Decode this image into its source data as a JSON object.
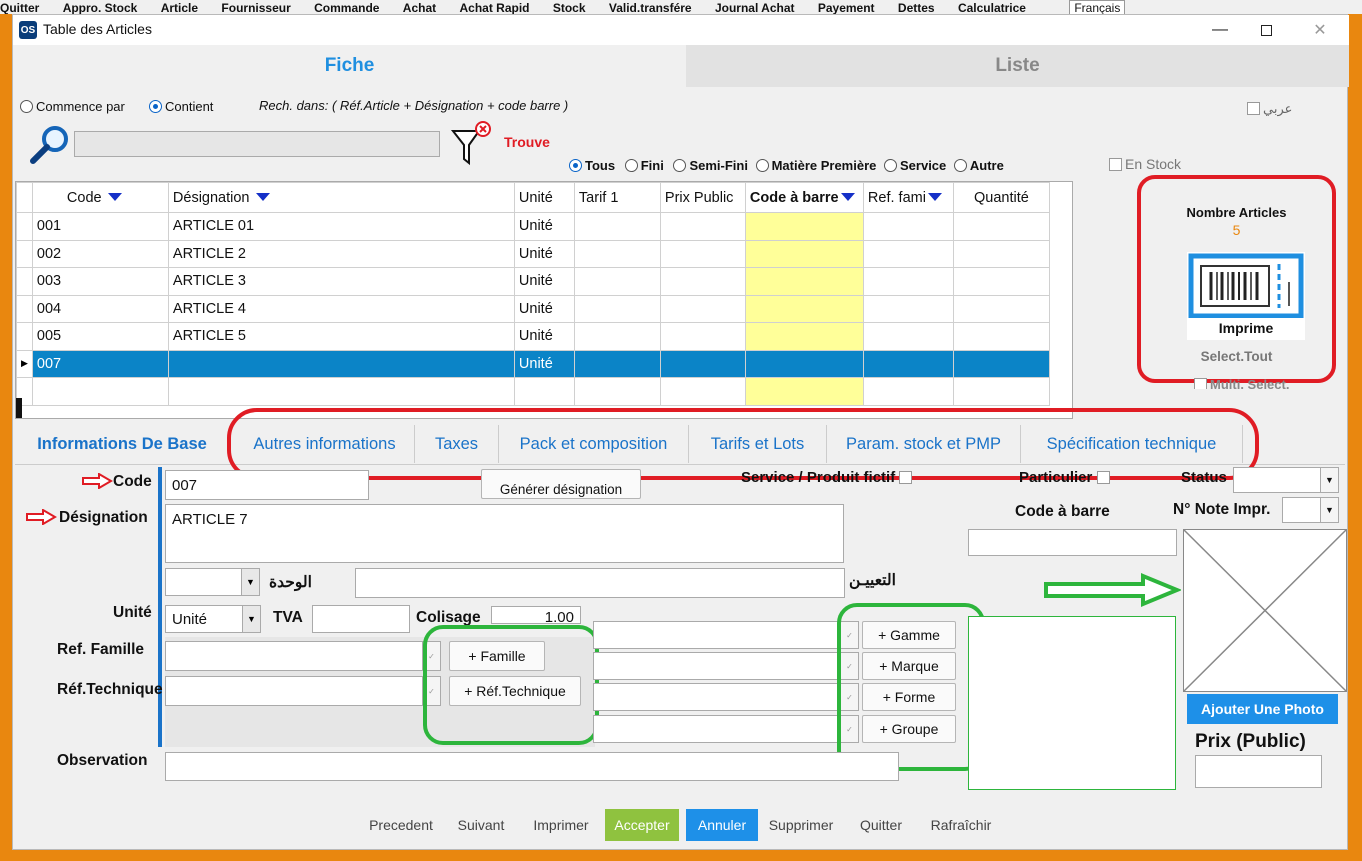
{
  "background_menubar": [
    "Quitter",
    "Appro. Stock",
    "Article",
    "Fournisseur",
    "Commande",
    "Achat",
    "Achat Rapid",
    "Stock",
    "Valid.transfére",
    "Journal Achat",
    "Payement",
    "Dettes",
    "Calculatrice",
    "Français"
  ],
  "window": {
    "logo": "OS",
    "title": "Table des Articles"
  },
  "top_tabs": {
    "fiche": "Fiche",
    "liste": "Liste"
  },
  "search": {
    "commence_par": "Commence par",
    "contient": "Contient",
    "rech_dans": "Rech. dans: ( Réf.Article + Désignation + code barre )",
    "arabic_check": "عربي",
    "value": "",
    "trouve": "Trouve",
    "filters": [
      "Tous",
      "Fini",
      "Semi-Fini",
      "Matière Première",
      "Service",
      "Autre"
    ],
    "selected_filter": "Tous",
    "en_stock": "En Stock"
  },
  "grid": {
    "columns": [
      "Code",
      "Désignation",
      "Unité",
      "Tarif 1",
      "Prix Public",
      "Code à barre",
      "Ref. fami",
      "Quantité"
    ],
    "rows": [
      [
        "001",
        "ARTICLE 01",
        "Unité",
        "",
        "",
        "",
        "",
        ""
      ],
      [
        "002",
        "ARTICLE 2",
        "Unité",
        "",
        "",
        "",
        "",
        ""
      ],
      [
        "003",
        "ARTICLE 3",
        "Unité",
        "",
        "",
        "",
        "",
        ""
      ],
      [
        "004",
        "ARTICLE 4",
        "Unité",
        "",
        "",
        "",
        "",
        ""
      ],
      [
        "005",
        "ARTICLE 5",
        "Unité",
        "",
        "",
        "",
        "",
        ""
      ],
      [
        "007",
        "",
        "Unité",
        "",
        "",
        "",
        "",
        ""
      ]
    ],
    "selected_index": 5
  },
  "side_panel": {
    "nombre_label": "Nombre Articles",
    "nombre_value": "5",
    "imprime": "Imprime",
    "select_tout": "Select.Tout",
    "multi_select": "Multi. Select."
  },
  "lower_tabs": [
    "Informations De Base",
    "Autres informations",
    "Taxes",
    "Pack et composition",
    "Tarifs et Lots",
    "Param. stock et PMP",
    "Spécification technique"
  ],
  "form": {
    "code_label": "Code",
    "code_value": "007",
    "generer": "Générer désignation",
    "service_label": "Service / Produit fictif",
    "particulier_label": "Particulier",
    "status_label": "Status",
    "designation_label": "Désignation",
    "designation_value": "ARTICLE 7",
    "code_barre_label": "Code à barre",
    "note_label": "N° Note Impr.",
    "wahda_label": "الوحدة",
    "taayin_label": "التعييـن",
    "unite_label": "Unité",
    "unite_value": "Unité",
    "tva_label": "TVA",
    "colisage_label": "Colisage",
    "colisage_value": "1.00",
    "ref_famille_label": "Ref. Famille",
    "ref_tech_label": "Réf.Technique",
    "add_famille": "+ Famille",
    "add_ref_tech": "+ Réf.Technique",
    "add_gamme": "+ Gamme",
    "add_marque": "+ Marque",
    "add_forme": "+ Forme",
    "add_groupe": "+ Groupe",
    "observation_label": "Observation",
    "ajouter_photo": "Ajouter Une Photo",
    "prix_public_label": "Prix (Public)"
  },
  "bottom_buttons": [
    "Precedent",
    "Suivant",
    "Imprimer",
    "Accepter",
    "Annuler",
    "Supprimer",
    "Quitter",
    "Rafraîchir"
  ],
  "colors": {
    "accent_blue": "#1f8fe0",
    "selected_row": "#0b84c7",
    "highlight_red": "#e01c24",
    "highlight_green": "#2db53c",
    "accept_green": "#8fc23f",
    "annuler_blue": "#1e90e8",
    "barcode_col": "#ffff99"
  }
}
